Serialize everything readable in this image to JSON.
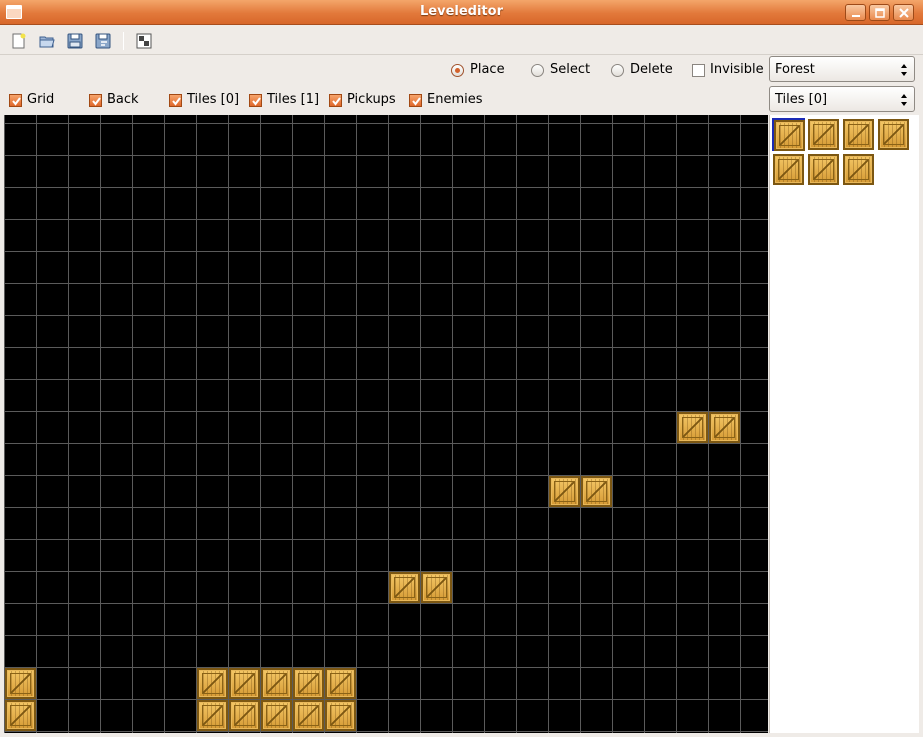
{
  "window": {
    "title": "Leveleditor"
  },
  "toolbar": {
    "buttons": [
      "new-file-icon",
      "open-folder-icon",
      "save-icon",
      "save-as-icon",
      "preview-icon"
    ]
  },
  "modes": {
    "place": {
      "label": "Place",
      "checked": true
    },
    "select": {
      "label": "Select",
      "checked": false
    },
    "delete": {
      "label": "Delete",
      "checked": false
    }
  },
  "invisible": {
    "label": "Invisible",
    "checked": false
  },
  "layers": {
    "grid": {
      "label": "Grid",
      "checked": true
    },
    "back": {
      "label": "Back",
      "checked": true
    },
    "tiles0": {
      "label": "Tiles [0]",
      "checked": true
    },
    "tiles1": {
      "label": "Tiles [1]",
      "checked": true
    },
    "pickups": {
      "label": "Pickups",
      "checked": true
    },
    "enemies": {
      "label": "Enemies",
      "checked": true
    }
  },
  "theme_select": {
    "value": "Forest"
  },
  "layer_select": {
    "value": "Tiles [0]"
  },
  "colors": {
    "canvas": "#000000",
    "grid_line": "#5b5b5b",
    "accent": "#e2793b",
    "selection": "#1b2ab5"
  },
  "level": {
    "cell_size": 32,
    "tiles": [
      {
        "col": 21,
        "row": 9
      },
      {
        "col": 22,
        "row": 9
      },
      {
        "col": 17,
        "row": 11
      },
      {
        "col": 18,
        "row": 11
      },
      {
        "col": 12,
        "row": 14
      },
      {
        "col": 13,
        "row": 14
      },
      {
        "col": 0,
        "row": 17
      },
      {
        "col": 6,
        "row": 17
      },
      {
        "col": 7,
        "row": 17
      },
      {
        "col": 8,
        "row": 17
      },
      {
        "col": 9,
        "row": 17
      },
      {
        "col": 10,
        "row": 17
      },
      {
        "col": 0,
        "row": 18
      },
      {
        "col": 6,
        "row": 18
      },
      {
        "col": 7,
        "row": 18
      },
      {
        "col": 8,
        "row": 18
      },
      {
        "col": 9,
        "row": 18
      },
      {
        "col": 10,
        "row": 18
      }
    ]
  },
  "palette": {
    "tile_count": 7,
    "selected_index": 0
  }
}
